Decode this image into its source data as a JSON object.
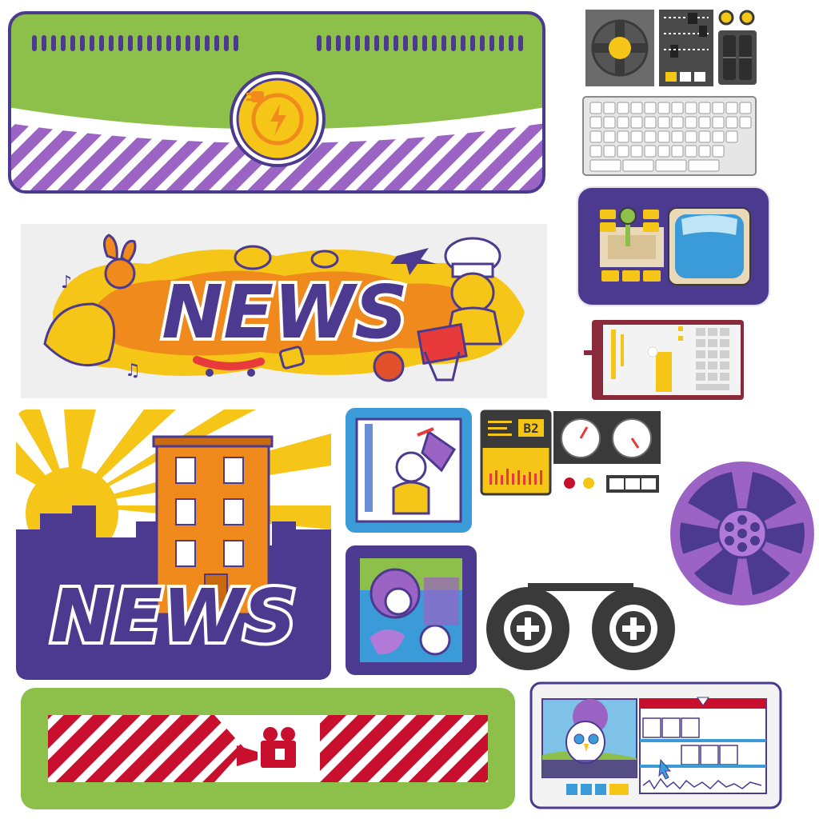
{
  "sheet": {
    "news_banner_word": "NEWS",
    "news_card_word": "NEWS",
    "console_screen_label": "B2"
  },
  "colors": {
    "purple": "#4b3a8f",
    "lavender": "#9b63c4",
    "green": "#8cc04a",
    "yellow": "#f5c518",
    "orange": "#f08a1c",
    "red": "#c8102e",
    "blue": "#3b9bd8",
    "gray": "#6b6b6b",
    "cream": "#efefef"
  },
  "icons": [
    "power-plug-icon",
    "joystick-dpad-icon",
    "mixer-sliders-icon",
    "switch-panel-icon",
    "keyboard-icon",
    "arcade-tv-icon",
    "tablet-keyboard-icon",
    "tv-news-studio-icon",
    "gauges-panel-icon",
    "film-reel-icon",
    "tape-reels-icon",
    "film-camera-icon",
    "video-editor-icon"
  ]
}
